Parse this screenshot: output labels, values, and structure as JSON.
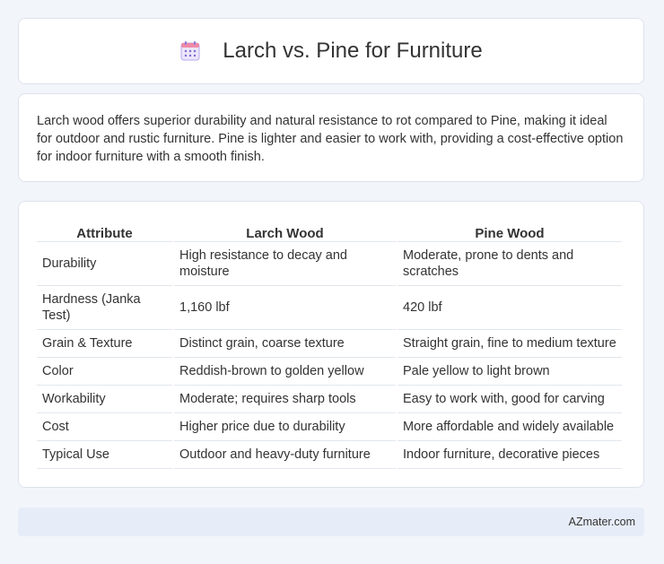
{
  "header": {
    "title": "Larch vs. Pine for Furniture",
    "icon": "calendar-icon"
  },
  "summary": {
    "text": "Larch wood offers superior durability and natural resistance to rot compared to Pine, making it ideal for outdoor and rustic furniture. Pine is lighter and easier to work with, providing a cost-effective option for indoor furniture with a smooth finish."
  },
  "table": {
    "headers": [
      "Attribute",
      "Larch Wood",
      "Pine Wood"
    ],
    "rows": [
      [
        "Durability",
        "High resistance to decay and moisture",
        "Moderate, prone to dents and scratches"
      ],
      [
        "Hardness (Janka Test)",
        "1,160 lbf",
        "420 lbf"
      ],
      [
        "Grain & Texture",
        "Distinct grain, coarse texture",
        "Straight grain, fine to medium texture"
      ],
      [
        "Color",
        "Reddish-brown to golden yellow",
        "Pale yellow to light brown"
      ],
      [
        "Workability",
        "Moderate; requires sharp tools",
        "Easy to work with, good for carving"
      ],
      [
        "Cost",
        "Higher price due to durability",
        "More affordable and widely available"
      ],
      [
        "Typical Use",
        "Outdoor and heavy-duty furniture",
        "Indoor furniture, decorative pieces"
      ]
    ]
  },
  "footer": {
    "text": "AZmater.com"
  }
}
